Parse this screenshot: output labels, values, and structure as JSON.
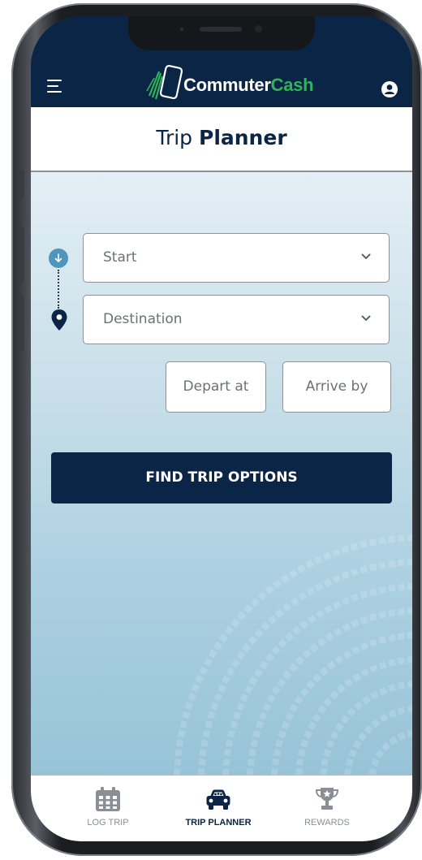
{
  "app": {
    "brand_primary": "Commuter",
    "brand_accent": "Cash",
    "menu_icon": "hamburger-menu-icon",
    "profile_icon": "user-avatar-icon"
  },
  "page": {
    "title_regular": "Trip",
    "title_bold": "Planner"
  },
  "planner": {
    "start_placeholder": "Start",
    "destination_placeholder": "Destination",
    "depart_label": "Depart at",
    "arrive_label": "Arrive by",
    "find_button": "FIND TRIP OPTIONS"
  },
  "tabs": [
    {
      "label": "LOG TRIP",
      "icon": "calendar-icon",
      "active": false
    },
    {
      "label": "TRIP PLANNER",
      "icon": "car-icon",
      "active": true
    },
    {
      "label": "REWARDS",
      "icon": "trophy-icon",
      "active": false
    }
  ],
  "colors": {
    "navy": "#0b2547",
    "brand_green": "#2fb558",
    "route_start": "#4e96bb",
    "tab_inactive": "#8a8f96"
  }
}
